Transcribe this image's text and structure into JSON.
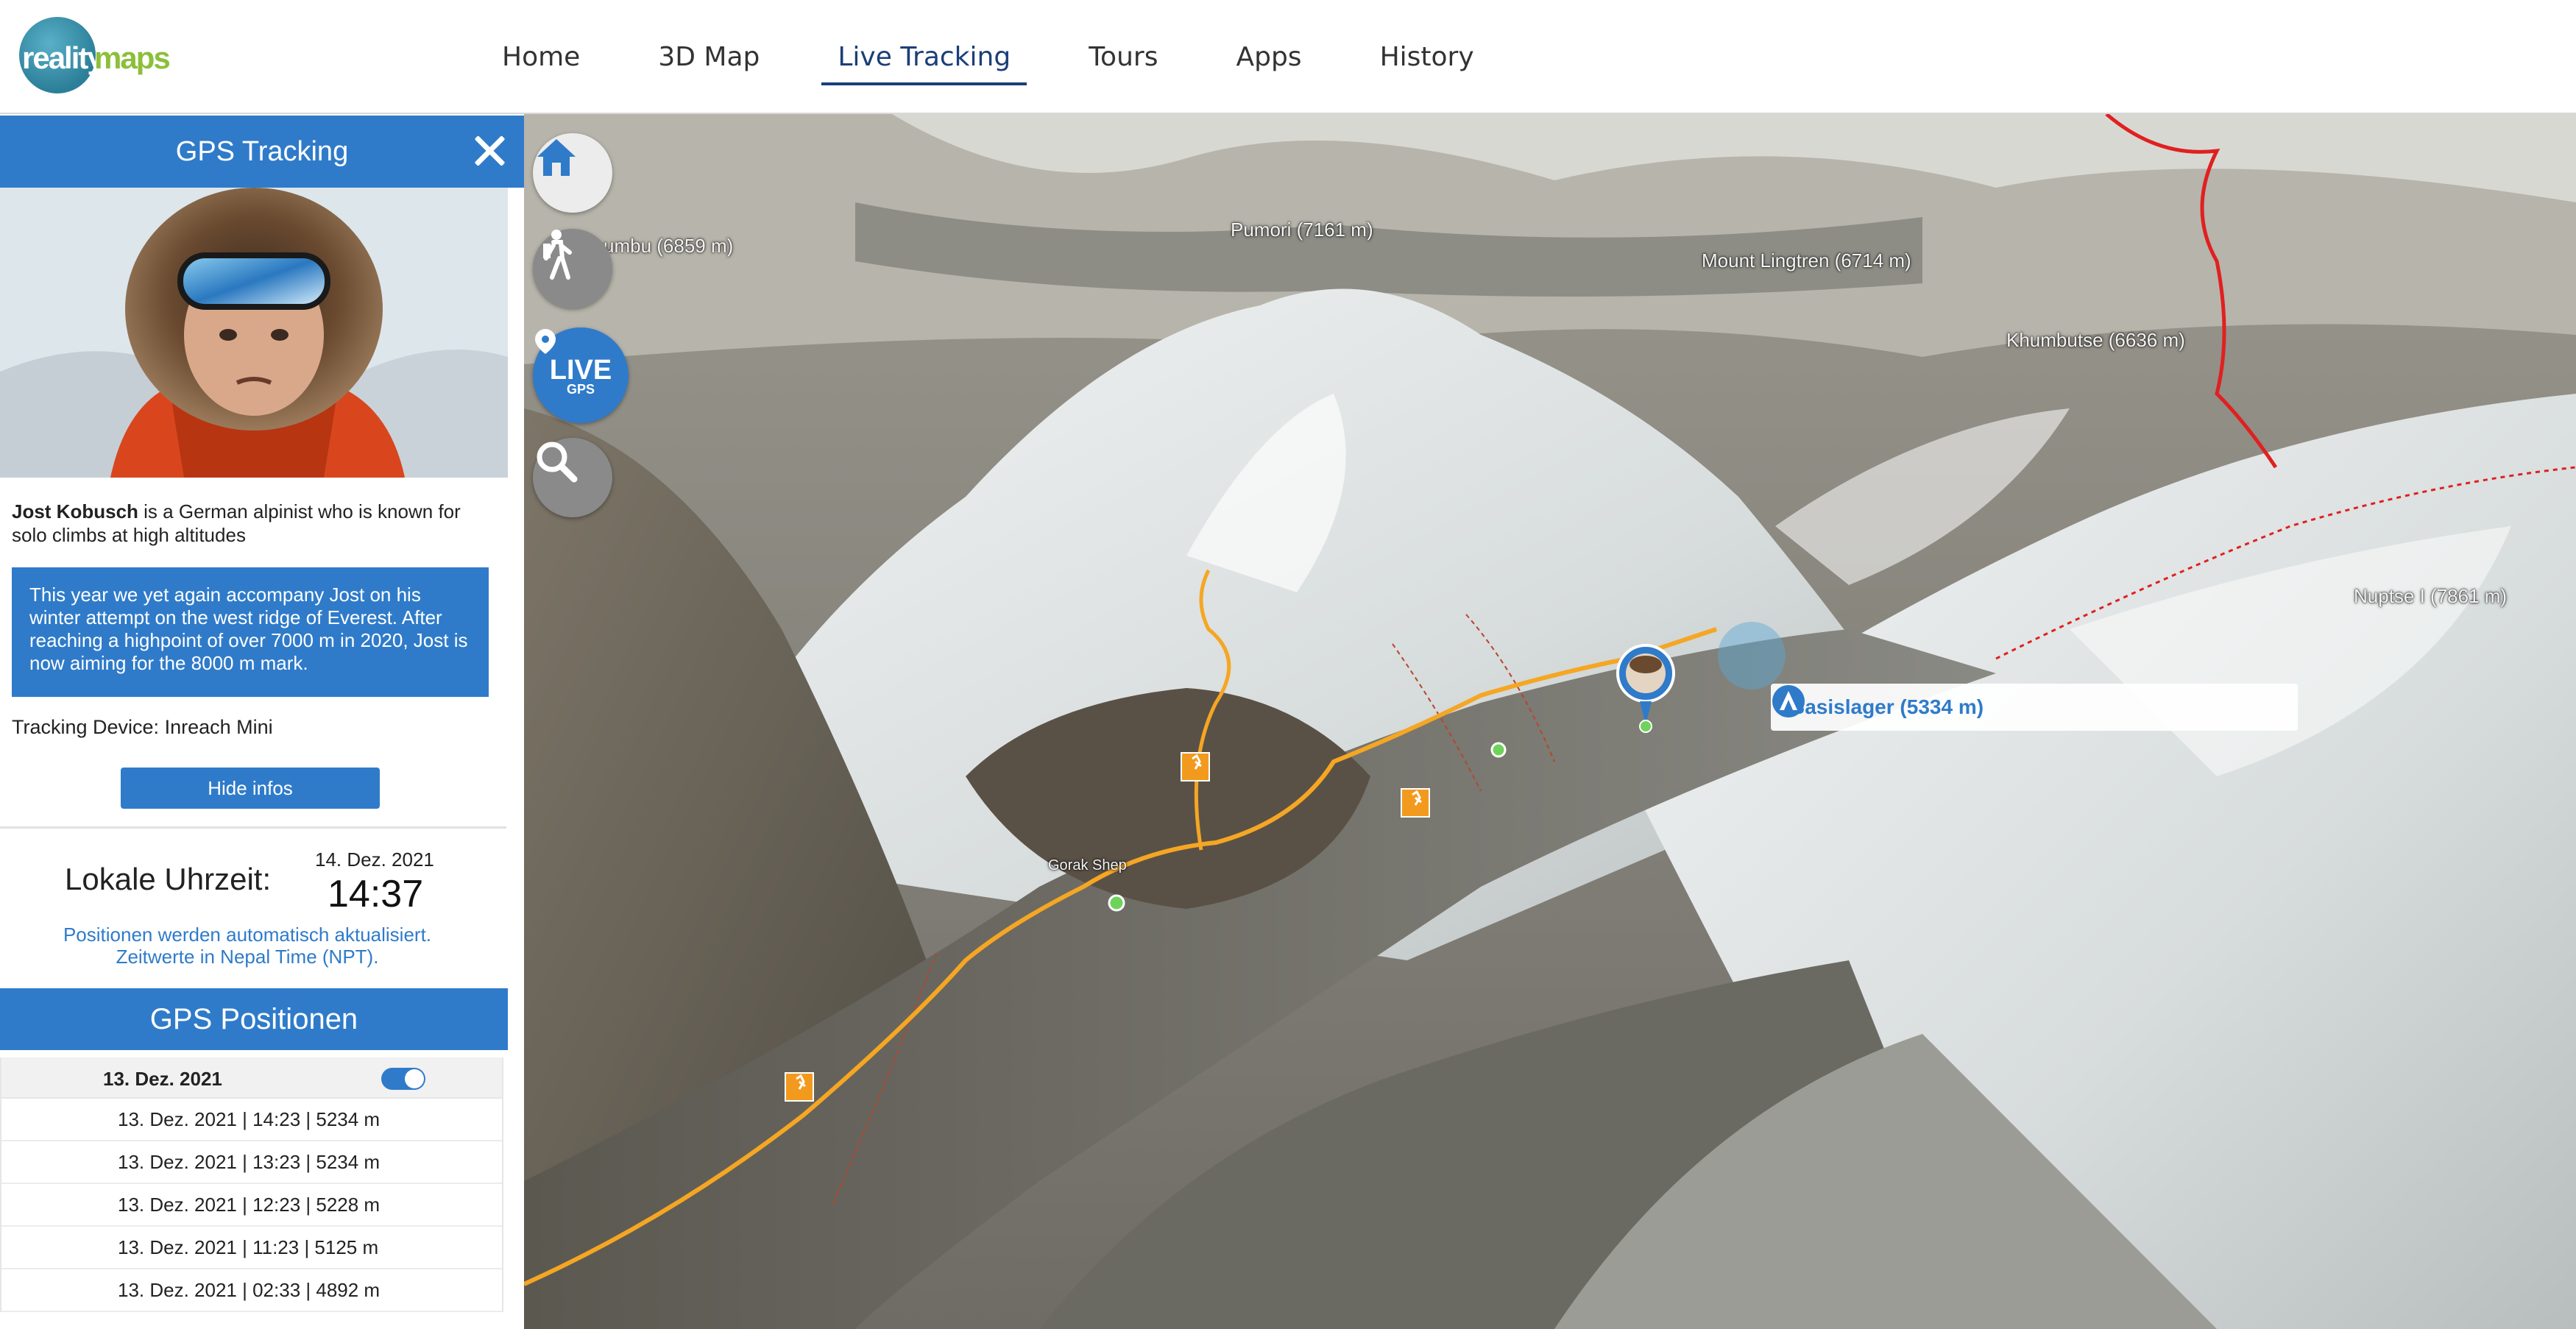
{
  "header": {
    "logo_text_1": "reality",
    "logo_text_2": "maps",
    "nav": [
      {
        "label": "Home"
      },
      {
        "label": "3D Map"
      },
      {
        "label": "Live Tracking"
      },
      {
        "label": "Tours"
      },
      {
        "label": "Apps"
      },
      {
        "label": "History"
      }
    ],
    "active_nav": "Live Tracking"
  },
  "sidebar": {
    "title": "GPS Tracking",
    "person_name": "Jost Kobusch",
    "person_desc": "is a German alpinist who is known for solo climbs at high altitudes",
    "note": "This year we yet again accompany Jost on his winter attempt on the west ridge of Everest. After reaching a highpoint of over 7000 m in 2020, Jost is now aiming for the 8000 m mark.",
    "device": "Tracking Device: Inreach Mini",
    "hide_button": "Hide infos",
    "clock_label": "Lokale Uhrzeit:",
    "clock_date": "14. Dez. 2021",
    "clock_time": "14:37",
    "auto_note_line1": "Positionen werden automatisch aktualisiert.",
    "auto_note_line2": "Zeitwerte in Nepal Time (NPT).",
    "gps_title": "GPS Positionen",
    "gps_group": "13. Dez. 2021",
    "gps_toggle_on": true,
    "gps_rows": [
      "13. Dez. 2021 | 14:23 | 5234 m",
      "13. Dez. 2021 | 13:23 | 5234 m",
      "13. Dez. 2021 | 12:23 | 5228 m",
      "13. Dez. 2021 | 11:23 | 5125 m",
      "13. Dez. 2021 | 02:33 | 4892 m"
    ]
  },
  "map": {
    "peaks": {
      "lobuche": "umbu (6859 m)",
      "pumori": "Pumori (7161 m)",
      "lingtren": "Mount Lingtren (6714 m)",
      "khumbutse": "Khumbutse (6636 m)",
      "nuptse": "Nuptse I (7861 m)",
      "gorakshep": "Gorak Shep"
    },
    "basecamp_label": "Basislager (5334 m)",
    "buttons": {
      "home": "home-icon",
      "tours": "hiker-icon",
      "live_main": "LIVE",
      "live_sub": "GPS",
      "search": "search-icon"
    },
    "colors": {
      "track": "#f5a623",
      "border": "#e02020",
      "accent": "#2f7bca"
    }
  }
}
